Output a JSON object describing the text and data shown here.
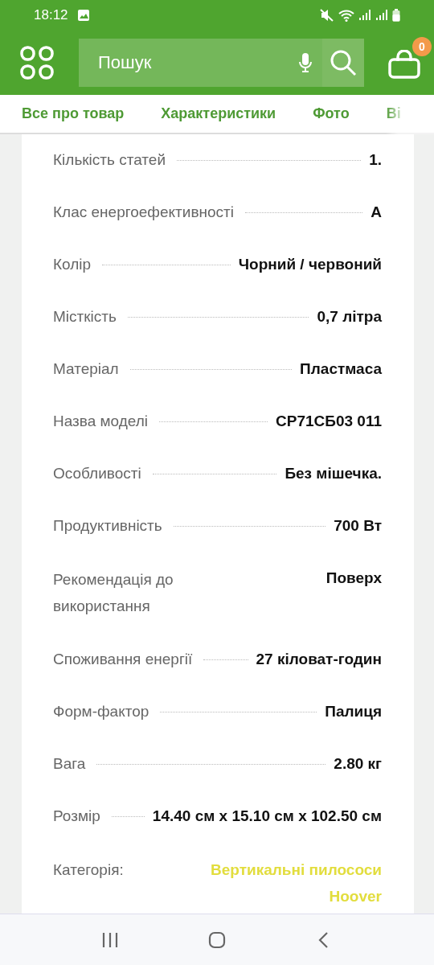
{
  "status_bar": {
    "time": "18:12"
  },
  "header": {
    "search": {
      "placeholder": "Пошук"
    },
    "cart": {
      "count": "0"
    }
  },
  "tabs": [
    {
      "label": "Все про товар"
    },
    {
      "label": "Характеристики"
    },
    {
      "label": "Фото"
    },
    {
      "label": "Ві"
    }
  ],
  "specs": [
    {
      "kind": "dotted",
      "label": "Кількість статей",
      "value": "1."
    },
    {
      "kind": "dotted",
      "label": "Клас енергоефективності",
      "value": "A"
    },
    {
      "kind": "dotted",
      "label": "Колір",
      "value": "Чорний / червоний"
    },
    {
      "kind": "dotted",
      "label": "Місткість",
      "value": "0,7 літра"
    },
    {
      "kind": "dotted",
      "label": "Матеріал",
      "value": "Пластмаса"
    },
    {
      "kind": "dotted",
      "label": "Назва моделі",
      "value": "CP71СБ03 011"
    },
    {
      "kind": "dotted",
      "label": "Особливості",
      "value": "Без мішечка."
    },
    {
      "kind": "dotted",
      "label": "Продуктивність",
      "value": "700 Вт"
    },
    {
      "kind": "plain",
      "label": "Рекомендація до використання",
      "value": "Поверх"
    },
    {
      "kind": "dotted",
      "label": "Споживання енергії",
      "value": "27 кіловат-годин"
    },
    {
      "kind": "dotted",
      "label": "Форм-фактор",
      "value": "Палиця"
    },
    {
      "kind": "dotted",
      "label": "Вага",
      "value": "2.80 кг"
    },
    {
      "kind": "dotted",
      "label": "Розмір",
      "value": "14.40 см x 15.10 см x 102.50 см"
    },
    {
      "kind": "link",
      "label": "Категорія:",
      "value": "Вертикальні пилососи Hoover"
    }
  ]
}
